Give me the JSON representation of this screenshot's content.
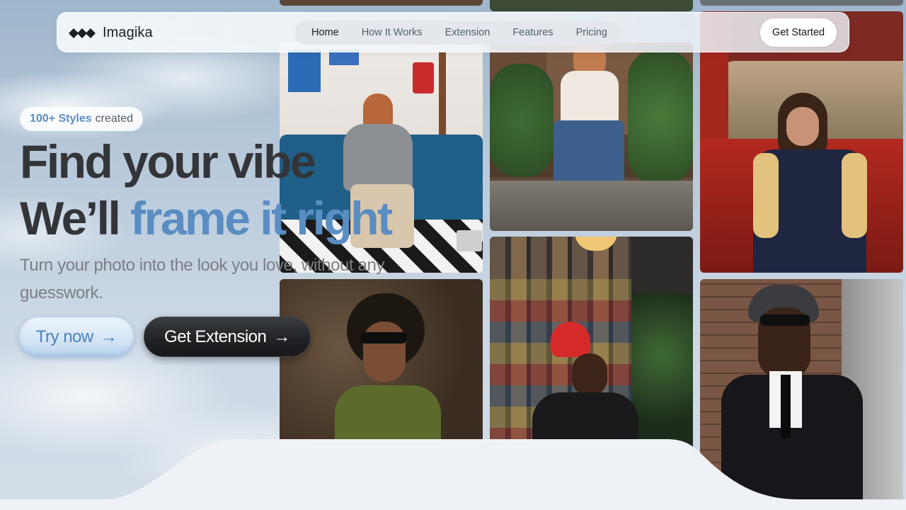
{
  "brand": {
    "name": "Imagika"
  },
  "nav": {
    "items": [
      {
        "label": "Home",
        "active": true
      },
      {
        "label": "How It Works",
        "active": false
      },
      {
        "label": "Extension",
        "active": false
      },
      {
        "label": "Features",
        "active": false
      },
      {
        "label": "Pricing",
        "active": false
      }
    ],
    "cta_label": "Get Started"
  },
  "hero": {
    "badge_strong": "100+ Styles",
    "badge_rest": "created",
    "headline_line1": "Find your vibe",
    "headline_line2_plain": "We’ll",
    "headline_line2_accent": "frame it right",
    "subtitle": "Turn your photo into the look you love, without any guesswork.",
    "try_label": "Try now",
    "extension_label": "Get Extension",
    "arrow_glyph": "→"
  },
  "colors": {
    "accent_blue": "#5a8dc2",
    "headline_dark": "#333538",
    "button_dark": "#1f2124"
  },
  "gallery": {
    "photos": [
      {
        "name": "photo-woman-sofa-guitar",
        "bg": "#e9e6e2"
      },
      {
        "name": "photo-woman-plants-steps",
        "bg": "#5e4a3c"
      },
      {
        "name": "photo-woman-red-car",
        "bg": "#7c2a22"
      },
      {
        "name": "photo-man-afro-sunglasses",
        "bg": "#4b3b2a"
      },
      {
        "name": "photo-man-poster-wall",
        "bg": "#2f2c2c"
      },
      {
        "name": "photo-man-flat-cap-brick",
        "bg": "#6b4d3e"
      }
    ]
  }
}
